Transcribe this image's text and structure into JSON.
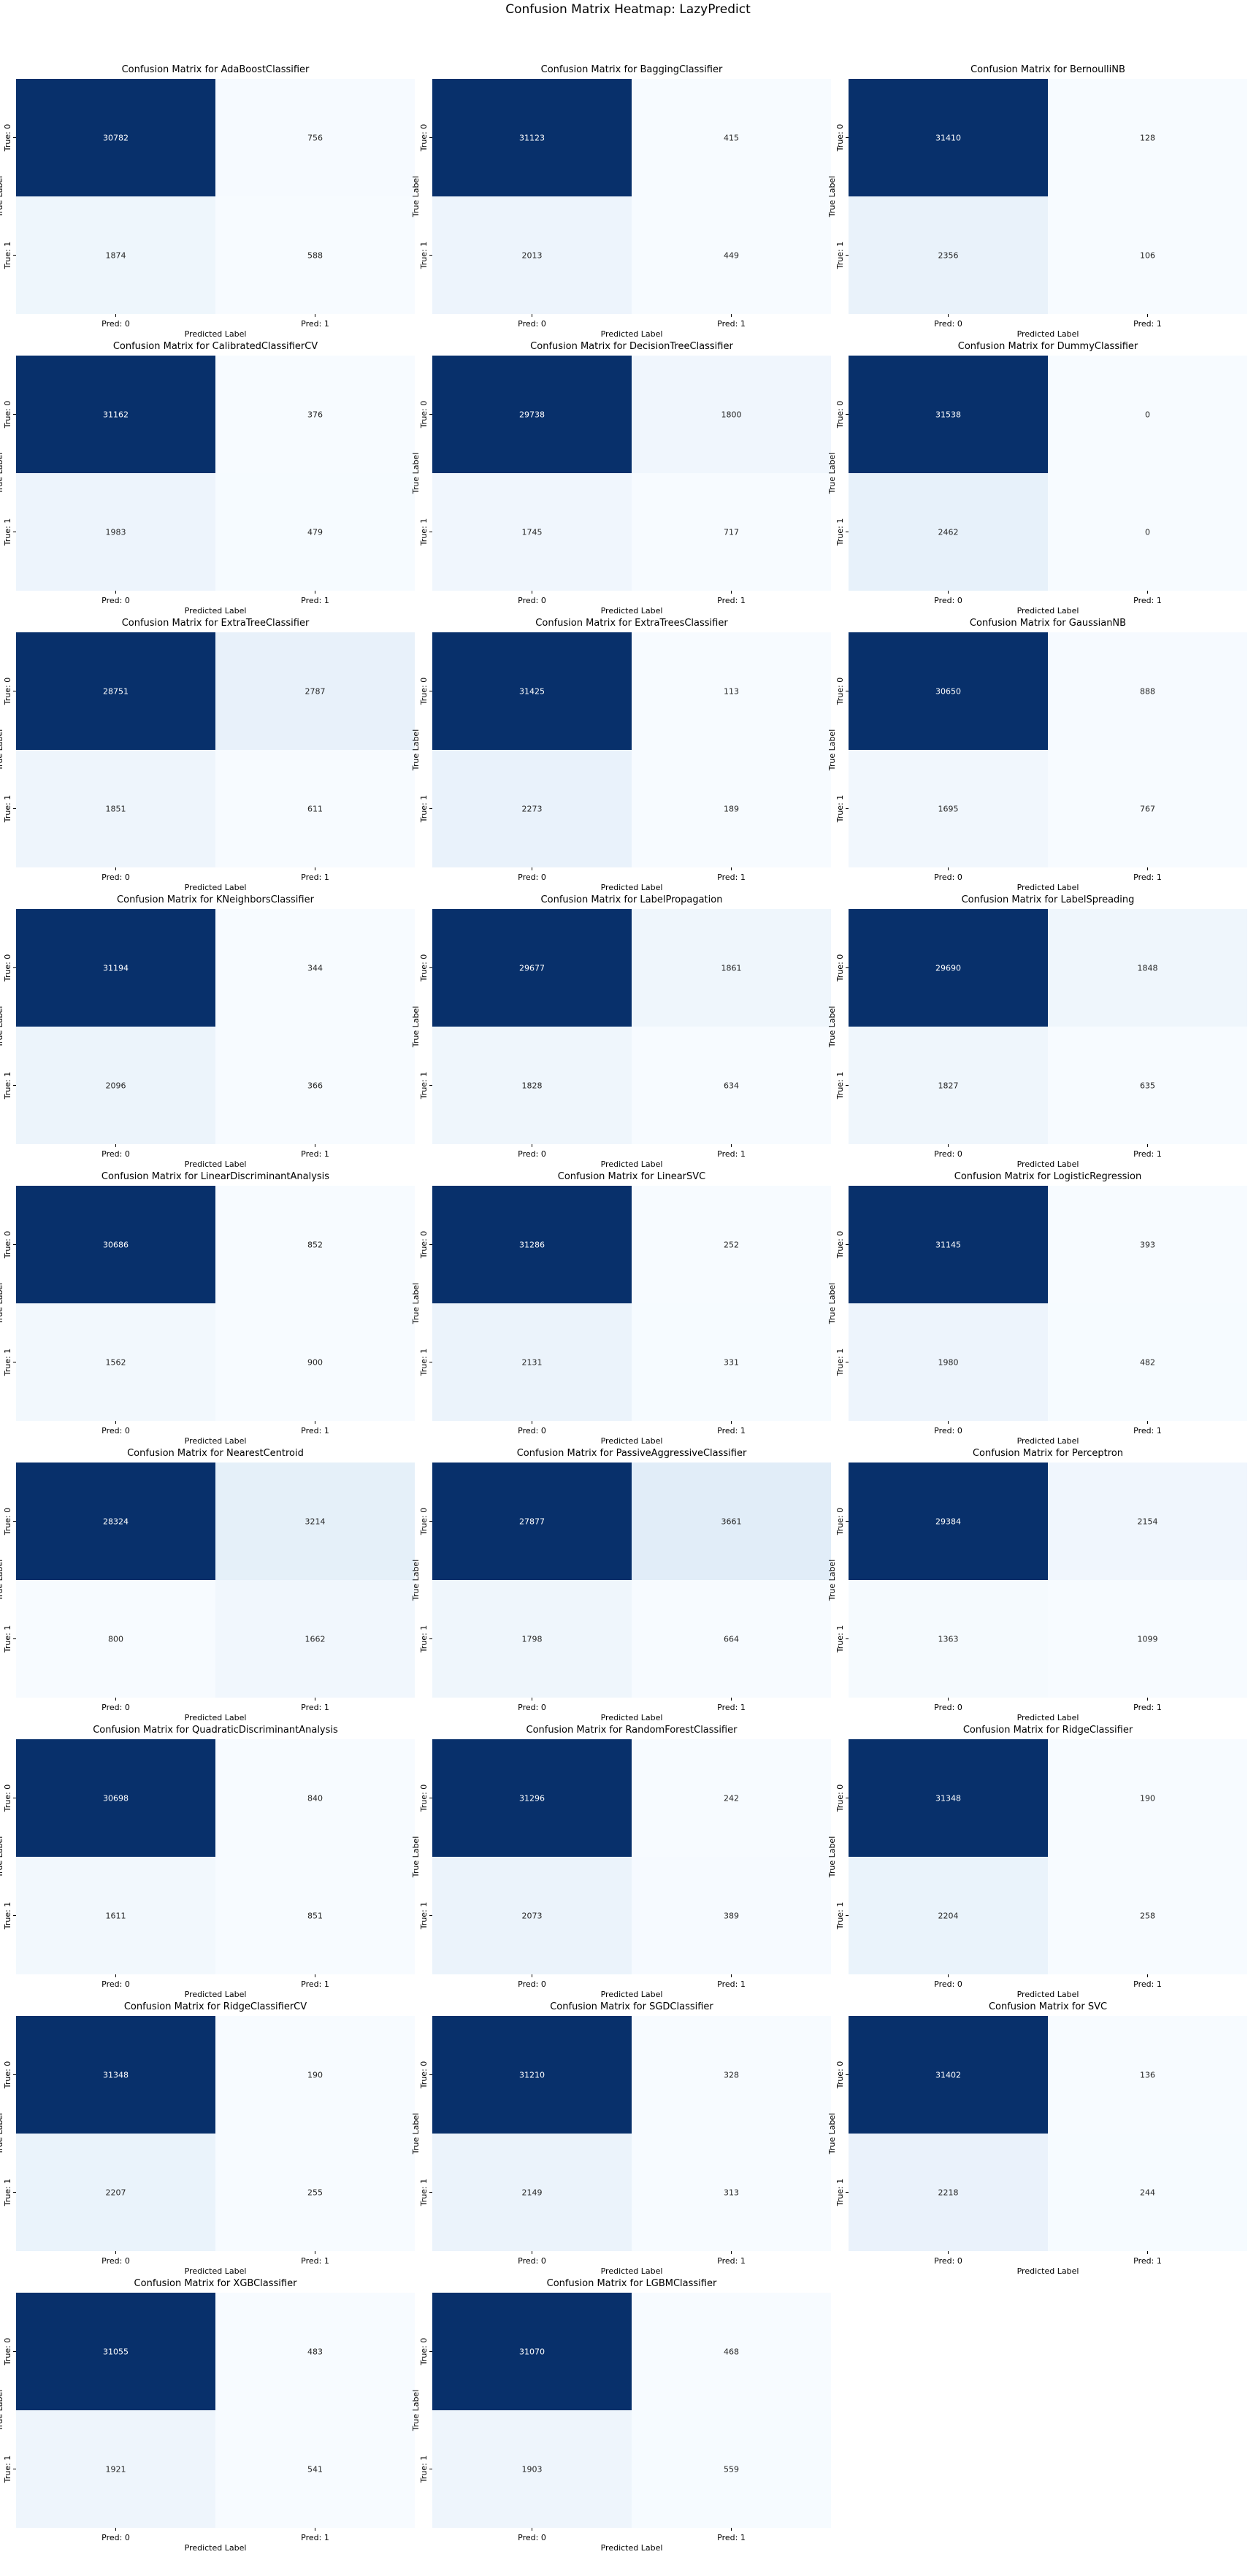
{
  "figure": {
    "suptitle": "Confusion Matrix Heatmap: LazyPredict"
  },
  "axis_text": {
    "x_label": "Predicted Label",
    "y_label": "True Label",
    "x_ticks": [
      "Pred: 0",
      "Pred: 1"
    ],
    "y_ticks": [
      "True: 0",
      "True: 1"
    ],
    "title_prefix": "Confusion Matrix for "
  },
  "colors": {
    "colormap": "Blues",
    "dark": "#08306b",
    "light": "#f7fbff",
    "text_on_dark": "#ffffff",
    "text_on_light": "#262626"
  },
  "chart_data": [
    {
      "type": "heatmap",
      "title": "Confusion Matrix for AdaBoostClassifier",
      "model": "AdaBoostClassifier",
      "matrix": [
        [
          30782,
          756
        ],
        [
          1874,
          588
        ]
      ]
    },
    {
      "type": "heatmap",
      "title": "Confusion Matrix for BaggingClassifier",
      "model": "BaggingClassifier",
      "matrix": [
        [
          31123,
          415
        ],
        [
          2013,
          449
        ]
      ]
    },
    {
      "type": "heatmap",
      "title": "Confusion Matrix for BernoulliNB",
      "model": "BernoulliNB",
      "matrix": [
        [
          31410,
          128
        ],
        [
          2356,
          106
        ]
      ]
    },
    {
      "type": "heatmap",
      "title": "Confusion Matrix for CalibratedClassifierCV",
      "model": "CalibratedClassifierCV",
      "matrix": [
        [
          31162,
          376
        ],
        [
          1983,
          479
        ]
      ]
    },
    {
      "type": "heatmap",
      "title": "Confusion Matrix for DecisionTreeClassifier",
      "model": "DecisionTreeClassifier",
      "matrix": [
        [
          29738,
          1800
        ],
        [
          1745,
          717
        ]
      ]
    },
    {
      "type": "heatmap",
      "title": "Confusion Matrix for DummyClassifier",
      "model": "DummyClassifier",
      "matrix": [
        [
          31538,
          0
        ],
        [
          2462,
          0
        ]
      ]
    },
    {
      "type": "heatmap",
      "title": "Confusion Matrix for ExtraTreeClassifier",
      "model": "ExtraTreeClassifier",
      "matrix": [
        [
          28751,
          2787
        ],
        [
          1851,
          611
        ]
      ]
    },
    {
      "type": "heatmap",
      "title": "Confusion Matrix for ExtraTreesClassifier",
      "model": "ExtraTreesClassifier",
      "matrix": [
        [
          31425,
          113
        ],
        [
          2273,
          189
        ]
      ]
    },
    {
      "type": "heatmap",
      "title": "Confusion Matrix for GaussianNB",
      "model": "GaussianNB",
      "matrix": [
        [
          30650,
          888
        ],
        [
          1695,
          767
        ]
      ]
    },
    {
      "type": "heatmap",
      "title": "Confusion Matrix for KNeighborsClassifier",
      "model": "KNeighborsClassifier",
      "matrix": [
        [
          31194,
          344
        ],
        [
          2096,
          366
        ]
      ]
    },
    {
      "type": "heatmap",
      "title": "Confusion Matrix for LabelPropagation",
      "model": "LabelPropagation",
      "matrix": [
        [
          29677,
          1861
        ],
        [
          1828,
          634
        ]
      ]
    },
    {
      "type": "heatmap",
      "title": "Confusion Matrix for LabelSpreading",
      "model": "LabelSpreading",
      "matrix": [
        [
          29690,
          1848
        ],
        [
          1827,
          635
        ]
      ]
    },
    {
      "type": "heatmap",
      "title": "Confusion Matrix for LinearDiscriminantAnalysis",
      "model": "LinearDiscriminantAnalysis",
      "matrix": [
        [
          30686,
          852
        ],
        [
          1562,
          900
        ]
      ]
    },
    {
      "type": "heatmap",
      "title": "Confusion Matrix for LinearSVC",
      "model": "LinearSVC",
      "matrix": [
        [
          31286,
          252
        ],
        [
          2131,
          331
        ]
      ]
    },
    {
      "type": "heatmap",
      "title": "Confusion Matrix for LogisticRegression",
      "model": "LogisticRegression",
      "matrix": [
        [
          31145,
          393
        ],
        [
          1980,
          482
        ]
      ]
    },
    {
      "type": "heatmap",
      "title": "Confusion Matrix for NearestCentroid",
      "model": "NearestCentroid",
      "matrix": [
        [
          28324,
          3214
        ],
        [
          800,
          1662
        ]
      ]
    },
    {
      "type": "heatmap",
      "title": "Confusion Matrix for PassiveAggressiveClassifier",
      "model": "PassiveAggressiveClassifier",
      "matrix": [
        [
          27877,
          3661
        ],
        [
          1798,
          664
        ]
      ]
    },
    {
      "type": "heatmap",
      "title": "Confusion Matrix for Perceptron",
      "model": "Perceptron",
      "matrix": [
        [
          29384,
          2154
        ],
        [
          1363,
          1099
        ]
      ]
    },
    {
      "type": "heatmap",
      "title": "Confusion Matrix for QuadraticDiscriminantAnalysis",
      "model": "QuadraticDiscriminantAnalysis",
      "matrix": [
        [
          30698,
          840
        ],
        [
          1611,
          851
        ]
      ]
    },
    {
      "type": "heatmap",
      "title": "Confusion Matrix for RandomForestClassifier",
      "model": "RandomForestClassifier",
      "matrix": [
        [
          31296,
          242
        ],
        [
          2073,
          389
        ]
      ]
    },
    {
      "type": "heatmap",
      "title": "Confusion Matrix for RidgeClassifier",
      "model": "RidgeClassifier",
      "matrix": [
        [
          31348,
          190
        ],
        [
          2204,
          258
        ]
      ]
    },
    {
      "type": "heatmap",
      "title": "Confusion Matrix for RidgeClassifierCV",
      "model": "RidgeClassifierCV",
      "matrix": [
        [
          31348,
          190
        ],
        [
          2207,
          255
        ]
      ]
    },
    {
      "type": "heatmap",
      "title": "Confusion Matrix for SGDClassifier",
      "model": "SGDClassifier",
      "matrix": [
        [
          31210,
          328
        ],
        [
          2149,
          313
        ]
      ]
    },
    {
      "type": "heatmap",
      "title": "Confusion Matrix for SVC",
      "model": "SVC",
      "matrix": [
        [
          31402,
          136
        ],
        [
          2218,
          244
        ]
      ]
    },
    {
      "type": "heatmap",
      "title": "Confusion Matrix for XGBClassifier",
      "model": "XGBClassifier",
      "matrix": [
        [
          31055,
          483
        ],
        [
          1921,
          541
        ]
      ]
    },
    {
      "type": "heatmap",
      "title": "Confusion Matrix for LGBMClassifier",
      "model": "LGBMClassifier",
      "matrix": [
        [
          31070,
          468
        ],
        [
          1903,
          559
        ]
      ]
    }
  ]
}
